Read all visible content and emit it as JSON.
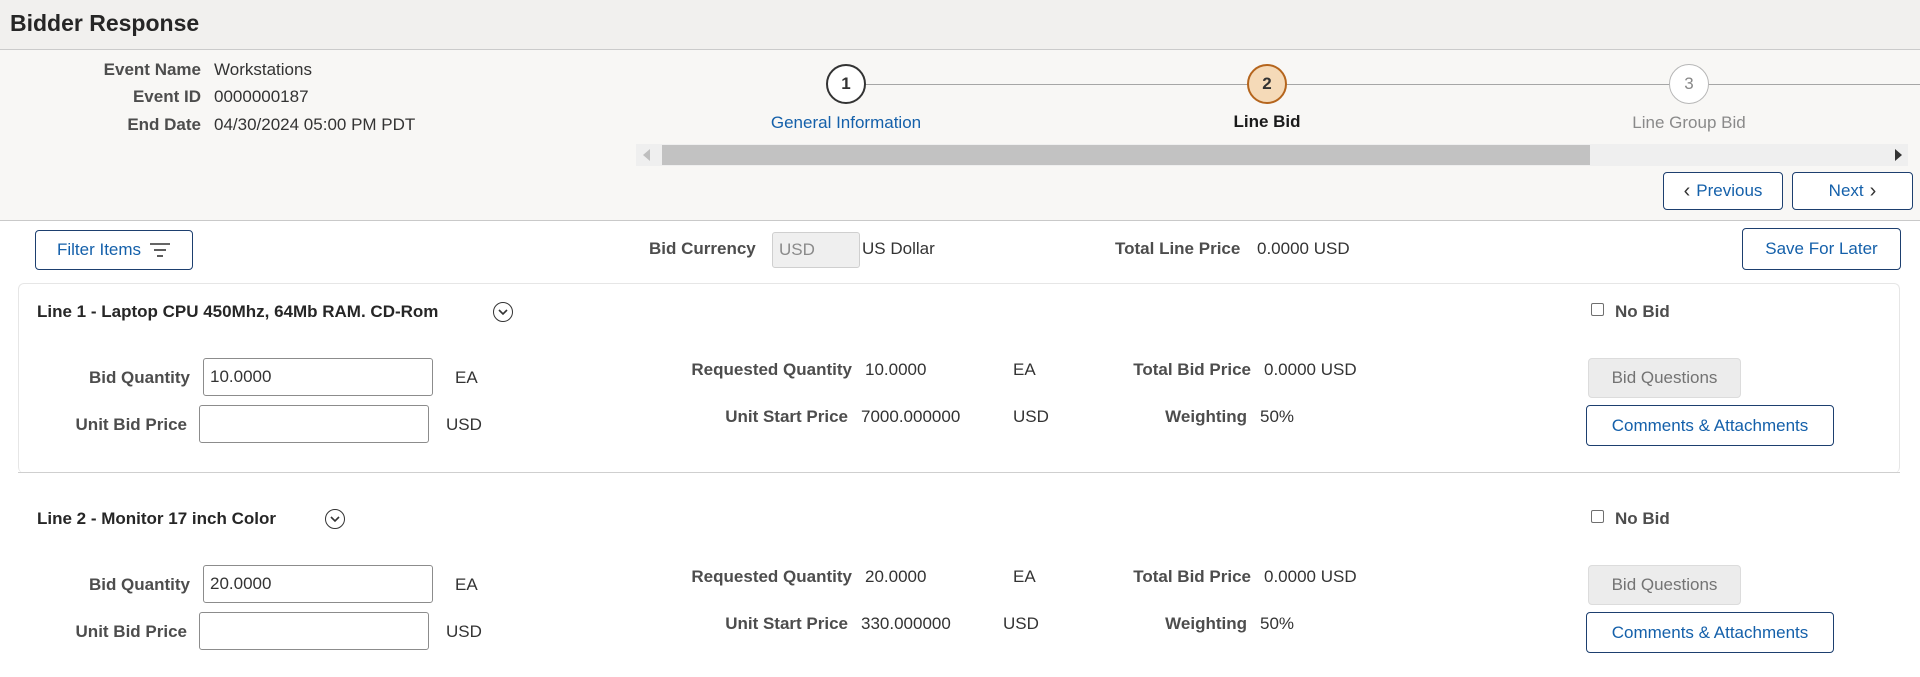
{
  "page": {
    "title": "Bidder Response"
  },
  "event": {
    "name_label": "Event Name",
    "name_value": "Workstations",
    "id_label": "Event ID",
    "id_value": "0000000187",
    "end_label": "End Date",
    "end_value": "04/30/2024 05:00 PM PDT"
  },
  "steps": [
    {
      "number": "1",
      "label": "General Information",
      "state": "link"
    },
    {
      "number": "2",
      "label": "Line Bid",
      "state": "current"
    },
    {
      "number": "3",
      "label": "Line Group Bid",
      "state": "future"
    }
  ],
  "nav": {
    "previous_label": "Previous",
    "next_label": "Next"
  },
  "toolbar": {
    "filter_label": "Filter Items",
    "bid_currency_label": "Bid Currency",
    "bid_currency_code": "USD",
    "bid_currency_name": "US Dollar",
    "total_line_price_label": "Total Line Price",
    "total_line_price_value": "0.0000 USD",
    "save_label": "Save For Later"
  },
  "lines": [
    {
      "title": "Line 1 - Laptop CPU 450Mhz, 64Mb RAM. CD-Rom",
      "no_bid_label": "No Bid",
      "bid_quantity_label": "Bid Quantity",
      "bid_quantity_value": "10.0000",
      "bid_quantity_uom": "EA",
      "unit_bid_price_label": "Unit Bid Price",
      "unit_bid_price_value": "",
      "unit_bid_price_currency": "USD",
      "requested_quantity_label": "Requested Quantity",
      "requested_quantity_value": "10.0000",
      "requested_quantity_uom": "EA",
      "unit_start_price_label": "Unit Start Price",
      "unit_start_price_value": "7000.000000",
      "unit_start_price_currency": "USD",
      "total_bid_price_label": "Total Bid Price",
      "total_bid_price_value": "0.0000 USD",
      "weighting_label": "Weighting",
      "weighting_value": "50%",
      "bid_questions_label": "Bid Questions",
      "comments_label": "Comments & Attachments"
    },
    {
      "title": "Line 2 - Monitor 17 inch Color",
      "no_bid_label": "No Bid",
      "bid_quantity_label": "Bid Quantity",
      "bid_quantity_value": "20.0000",
      "bid_quantity_uom": "EA",
      "unit_bid_price_label": "Unit Bid Price",
      "unit_bid_price_value": "",
      "unit_bid_price_currency": "USD",
      "requested_quantity_label": "Requested Quantity",
      "requested_quantity_value": "20.0000",
      "requested_quantity_uom": "EA",
      "unit_start_price_label": "Unit Start Price",
      "unit_start_price_value": "330.000000",
      "unit_start_price_currency": "USD",
      "total_bid_price_label": "Total Bid Price",
      "total_bid_price_value": "0.0000 USD",
      "weighting_label": "Weighting",
      "weighting_value": "50%",
      "bid_questions_label": "Bid Questions",
      "comments_label": "Comments & Attachments"
    }
  ],
  "colors": {
    "link": "#1460aa",
    "current_step_fill": "#f5dab8",
    "current_step_border": "#b5651d"
  }
}
